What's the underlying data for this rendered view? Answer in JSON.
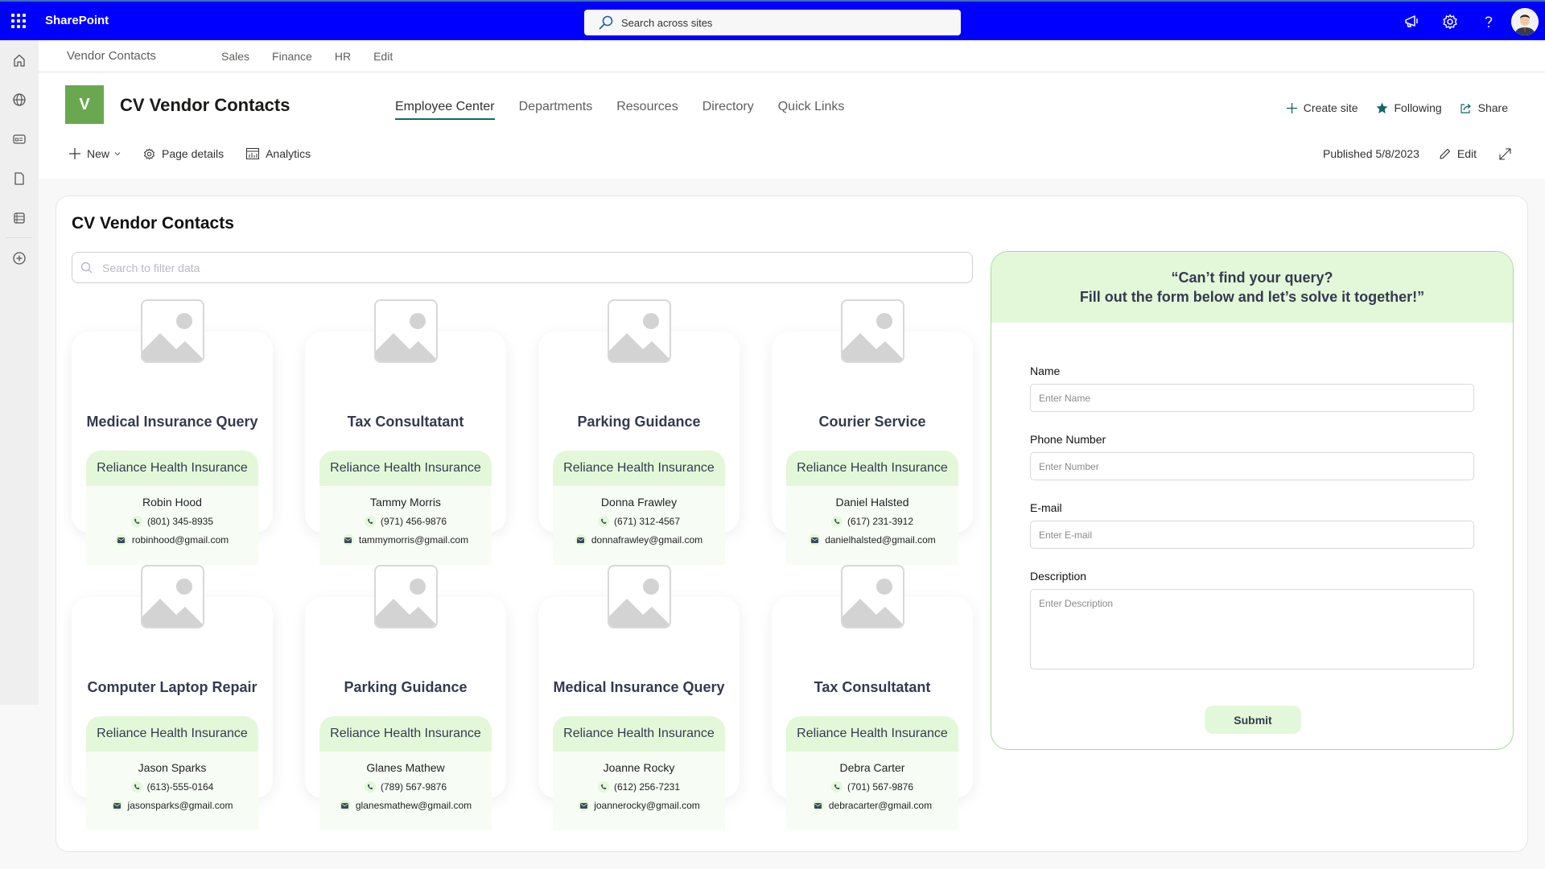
{
  "suitebar": {
    "app_name": "SharePoint",
    "search_placeholder": "Search across sites",
    "icons": [
      "megaphone-icon",
      "gear-icon",
      "help-icon",
      "avatar"
    ]
  },
  "rail": {
    "items": [
      "home-icon",
      "globe-icon",
      "news-icon",
      "document-icon",
      "list-icon",
      "add-circle-icon"
    ]
  },
  "hubnav": {
    "title": "Vendor Contacts",
    "links": [
      "Sales",
      "Finance",
      "HR",
      "Edit"
    ]
  },
  "site": {
    "logo_letter": "V",
    "title": "CV Vendor Contacts",
    "tabs": [
      "Employee Center",
      "Departments",
      "Resources",
      "Directory",
      "Quick Links"
    ],
    "active_tab": "Employee Center",
    "actions": {
      "create_site": "Create site",
      "following": "Following",
      "share": "Share"
    }
  },
  "commandbar": {
    "new": "New",
    "page_details": "Page details",
    "analytics": "Analytics",
    "published": "Published 5/8/2023",
    "edit": "Edit"
  },
  "main": {
    "title": "CV Vendor Contacts",
    "filter_placeholder": "Search to filter data",
    "cards": [
      {
        "title": "Medical Insurance Query",
        "company": "Reliance Health Insurance",
        "person": "Robin Hood",
        "phone": "(801) 345-8935",
        "email": "robinhood@gmail.com"
      },
      {
        "title": "Tax Consultatant",
        "company": "Reliance Health Insurance",
        "person": "Tammy Morris",
        "phone": "(971) 456-9876",
        "email": "tammymorris@gmail.com"
      },
      {
        "title": "Parking Guidance",
        "company": "Reliance Health Insurance",
        "person": "Donna Frawley",
        "phone": "(671) 312-4567",
        "email": "donnafrawley@gmail.com"
      },
      {
        "title": "Courier Service",
        "company": "Reliance Health Insurance",
        "person": "Daniel Halsted",
        "phone": "(617) 231-3912",
        "email": "danielhalsted@gmail.com"
      },
      {
        "title": "Computer Laptop Repair",
        "company": "Reliance Health Insurance",
        "person": "Jason Sparks",
        "phone": "(613)-555-0164",
        "email": "jasonsparks@gmail.com"
      },
      {
        "title": "Parking Guidance",
        "company": "Reliance Health Insurance",
        "person": "Glanes Mathew",
        "phone": "(789) 567-9876",
        "email": "glanesmathew@gmail.com"
      },
      {
        "title": "Medical Insurance Query",
        "company": "Reliance Health Insurance",
        "person": "Joanne Rocky",
        "phone": "(612) 256-7231",
        "email": "joannerocky@gmail.com"
      },
      {
        "title": "Tax Consultatant",
        "company": "Reliance Health Insurance",
        "person": "Debra Carter",
        "phone": "(701) 567-9876",
        "email": "debracarter@gmail.com"
      }
    ]
  },
  "form": {
    "heading_line1": "“Can’t find your query?",
    "heading_line2": "Fill out the form below and let’s solve it together!”",
    "fields": {
      "name_label": "Name",
      "name_placeholder": "Enter Name",
      "phone_label": "Phone Number",
      "phone_placeholder": "Enter Number",
      "email_label": "E-mail",
      "email_placeholder": "Enter E-mail",
      "description_label": "Description",
      "description_placeholder": "Enter Description"
    },
    "submit_label": "Submit"
  },
  "colors": {
    "suitebar": "#0000ff",
    "site_logo": "#6aa84f",
    "accent_teal": "#0b6a6a",
    "card_green": "#e3f8d9",
    "form_border": "#a9d89a"
  }
}
